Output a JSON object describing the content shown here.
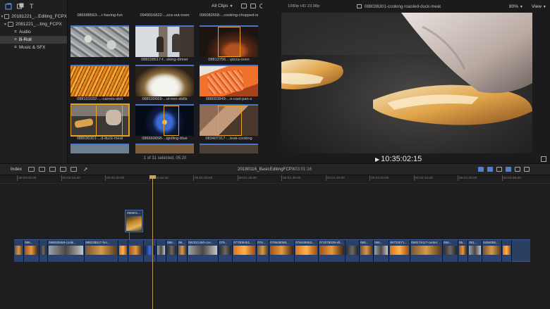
{
  "sidebar": {
    "items": [
      {
        "label": "20181221_...Editing_FCPX",
        "kind": "library"
      },
      {
        "label": "2081221_...ting_FCPX",
        "kind": "event"
      },
      {
        "label": "Audio",
        "kind": "keyword"
      },
      {
        "label": "B-Roll",
        "kind": "keyword",
        "selected": true
      },
      {
        "label": "Music & SFX",
        "kind": "keyword"
      }
    ]
  },
  "browser": {
    "filter": "All Clips",
    "footer": "1 of 31 selected, 05:20",
    "clips": [
      {
        "name": "086588563-...r-having-fun",
        "thumb": "oysters"
      },
      {
        "name": "0949016822-...zza-out-oven",
        "thumb": "kitchen-window"
      },
      {
        "name": "096082658-...cooking-chopped-or",
        "thumb": "chef-dark"
      },
      {
        "name": "",
        "thumb": "oysters-close"
      },
      {
        "name": "088228517-f...oking-dinner",
        "thumb": "kitchen-window"
      },
      {
        "name": "08813756...-pizza-oven",
        "thumb": "pizza-oven"
      },
      {
        "name": "088101032-...-carrots-skill",
        "thumb": "carrots"
      },
      {
        "name": "088100669-...st-iron-skills",
        "thumb": "rice"
      },
      {
        "name": "088093849-...n-cast-pan-s",
        "thumb": "salmon"
      },
      {
        "name": "088036301-...d-duck-meat",
        "thumb": "duck",
        "selected": true
      },
      {
        "name": "086660658-...ignlling-blue",
        "thumb": "blue-flame"
      },
      {
        "name": "083407317-...teak-cooking",
        "thumb": "steak"
      }
    ]
  },
  "viewer": {
    "format": "1080p HD 23.98p",
    "clip_name": "088036301-cooking-roasted-duck-meat",
    "zoom": "80%",
    "view_label": "View",
    "timecode": "10:35:02:15"
  },
  "timeline_bar": {
    "index_label": "Index",
    "project_name": "20180116_BasicEditingFCPX",
    "duration": "03:01:16"
  },
  "timeline": {
    "ruler": [
      "00:00:00:00",
      "00:00:15:00",
      "00:00:30:00",
      "00:00:45:00",
      "00:01:00:00",
      "00:01:15:00",
      "00:01:30:00",
      "00:01:45:00",
      "00:02:00:00",
      "00:02:15:00",
      "00:02:30:00",
      "00:02:45:00"
    ],
    "connected_clip": "086801...",
    "segments": [
      {
        "label": "",
        "tone": "food"
      },
      {
        "label": "086...",
        "tone": "warm"
      },
      {
        "label": "",
        "tone": "dark"
      },
      {
        "label": "096082658-cooki...",
        "tone": "kitchen"
      },
      {
        "label": "088228517-foo...",
        "tone": "food"
      },
      {
        "label": "",
        "tone": "orange"
      },
      {
        "label": "",
        "tone": "warm"
      },
      {
        "label": "",
        "tone": "blue"
      },
      {
        "label": "",
        "tone": "kitchen"
      },
      {
        "label": "088...",
        "tone": "dark"
      },
      {
        "label": "08...",
        "tone": "food"
      },
      {
        "label": "082321450-coo...",
        "tone": "kitchen"
      },
      {
        "label": "079...",
        "tone": "dark"
      },
      {
        "label": "077009451...",
        "tone": "orange"
      },
      {
        "label": "078...",
        "tone": "food"
      },
      {
        "label": "076649066...",
        "tone": "warm"
      },
      {
        "label": "078449553...",
        "tone": "orange"
      },
      {
        "label": "072078035-sll...",
        "tone": "warm"
      },
      {
        "label": "",
        "tone": "dark"
      },
      {
        "label": "068...",
        "tone": "food"
      },
      {
        "label": "066...",
        "tone": "kitchen"
      },
      {
        "label": "06733071...",
        "tone": "orange"
      },
      {
        "label": "058174417-center...",
        "tone": "food"
      },
      {
        "label": "058...",
        "tone": "dark"
      },
      {
        "label": "05...",
        "tone": "warm"
      },
      {
        "label": "051...",
        "tone": "kitchen"
      },
      {
        "label": "0494058...",
        "tone": "food"
      },
      {
        "label": "",
        "tone": "orange"
      }
    ]
  },
  "colors": {
    "accent_blue": "#3d5a92",
    "selection_yellow": "#e7a21d",
    "playhead": "#b79a54",
    "panel": "#1b1b1d"
  }
}
